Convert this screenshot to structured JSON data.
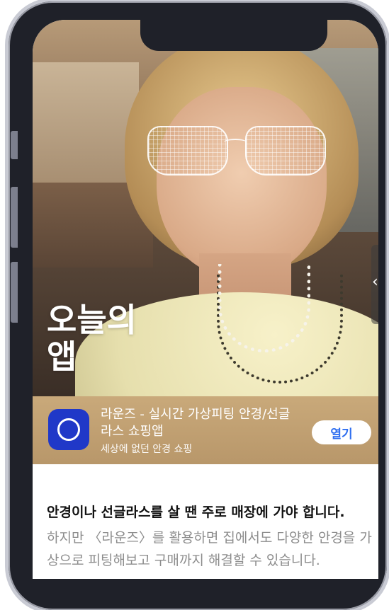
{
  "hero": {
    "title_line1": "오늘의",
    "title_line2": "앱",
    "side_handle_icon": "chevron-left-icon"
  },
  "app": {
    "name": "라운즈 - 실시간 가상피팅 안경/선글라스 쇼핑앱",
    "subtitle": "세상에 없던 안경 쇼핑",
    "open_button": "열기",
    "icon": "rounz-circle-icon"
  },
  "article": {
    "lead": "안경이나 선글라스를 살 땐 주로 매장에 가야 합니다.",
    "body": "하지만 〈라운즈〉를 활용하면 집에서도 다양한 안경을 가상으로 피팅해보고 구매까지 해결할 수 있습니다."
  },
  "colors": {
    "app_bar": "#c0a071",
    "app_icon": "#2038c8",
    "open_button_text": "#2f6ff0"
  }
}
